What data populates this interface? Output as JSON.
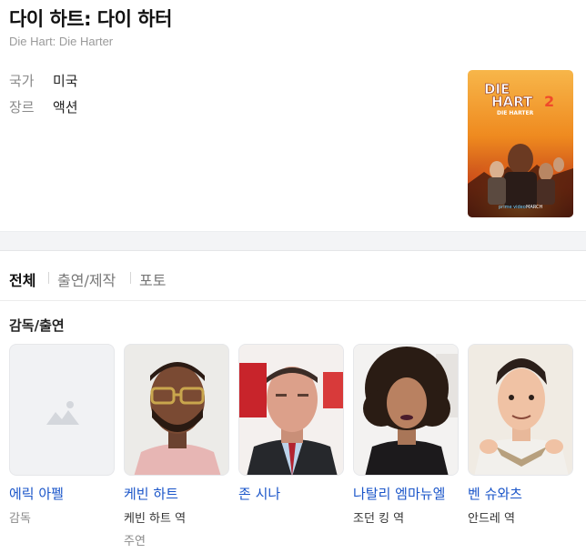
{
  "header": {
    "title": "다이 하트: 다이 하터",
    "original_title": "Die Hart: Die Harter"
  },
  "info": [
    {
      "label": "국가",
      "value": "미국"
    },
    {
      "label": "장르",
      "value": "액션"
    }
  ],
  "poster": {
    "title_line1": "DIE",
    "title_line2": "HART",
    "title_number": "2",
    "subtitle": "DIE HARTER",
    "badge_left": "prime video",
    "badge_right": "MARCH"
  },
  "tabs": [
    {
      "label": "전체"
    },
    {
      "label": "출연/제작"
    },
    {
      "label": "포토"
    }
  ],
  "cast_section": {
    "title": "감독/출연",
    "people": [
      {
        "name": "에릭 아펠",
        "role": "감독",
        "type": ""
      },
      {
        "name": "케빈 하트",
        "role": "케빈 하트 역",
        "type": "주연"
      },
      {
        "name": "존 시나",
        "role": "",
        "type": ""
      },
      {
        "name": "나탈리 엠마뉴엘",
        "role": "조던 킹 역",
        "type": ""
      },
      {
        "name": "벤 슈와츠",
        "role": "안드레 역",
        "type": ""
      }
    ]
  },
  "colors": {
    "link": "#1a55c9",
    "muted": "#8a8a8a",
    "band": "#f3f4f6"
  }
}
